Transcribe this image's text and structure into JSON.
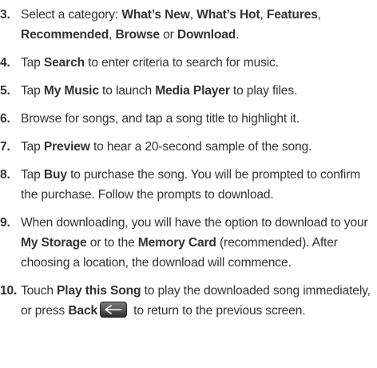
{
  "steps": [
    {
      "number": "3.",
      "parts": [
        {
          "text": "Select a category: "
        },
        {
          "text": "What’s New",
          "bold": true
        },
        {
          "text": ", "
        },
        {
          "text": "What’s Hot",
          "bold": true
        },
        {
          "text": ", "
        },
        {
          "text": "Features",
          "bold": true
        },
        {
          "text": ", "
        },
        {
          "text": "Recommended",
          "bold": true
        },
        {
          "text": ", "
        },
        {
          "text": "Browse",
          "bold": true
        },
        {
          "text": " or "
        },
        {
          "text": "Download",
          "bold": true
        },
        {
          "text": "."
        }
      ]
    },
    {
      "number": "4.",
      "parts": [
        {
          "text": "Tap "
        },
        {
          "text": "Search",
          "bold": true
        },
        {
          "text": " to enter criteria to search for music."
        }
      ]
    },
    {
      "number": "5.",
      "parts": [
        {
          "text": "Tap "
        },
        {
          "text": "My Music",
          "bold": true
        },
        {
          "text": " to launch "
        },
        {
          "text": "Media Player",
          "bold": true
        },
        {
          "text": " to play files."
        }
      ]
    },
    {
      "number": "6.",
      "parts": [
        {
          "text": "Browse for songs, and tap a song title to highlight it."
        }
      ]
    },
    {
      "number": "7.",
      "parts": [
        {
          "text": "Tap "
        },
        {
          "text": "Preview",
          "bold": true
        },
        {
          "text": " to hear a 20-second sample of the song."
        }
      ]
    },
    {
      "number": "8.",
      "parts": [
        {
          "text": "Tap "
        },
        {
          "text": "Buy",
          "bold": true
        },
        {
          "text": " to purchase the song.  You will be prompted to confirm the purchase.  Follow the prompts to download."
        }
      ]
    },
    {
      "number": "9.",
      "parts": [
        {
          "text": "When downloading, you will have the option to download to your "
        },
        {
          "text": "My Storage",
          "bold": true
        },
        {
          "text": " or to the "
        },
        {
          "text": "Memory Card",
          "bold": true
        },
        {
          "text": " (recommended). After choosing a location, the download will commence."
        }
      ]
    },
    {
      "number": "10.",
      "parts": [
        {
          "text": "Touch "
        },
        {
          "text": "Play this Song",
          "bold": true
        },
        {
          "text": " to play the downloaded song immediately, or press "
        },
        {
          "text": "Back",
          "bold": true
        },
        {
          "icon": "back-arrow-key-icon"
        },
        {
          "text": " to return to the previous screen."
        }
      ]
    }
  ]
}
